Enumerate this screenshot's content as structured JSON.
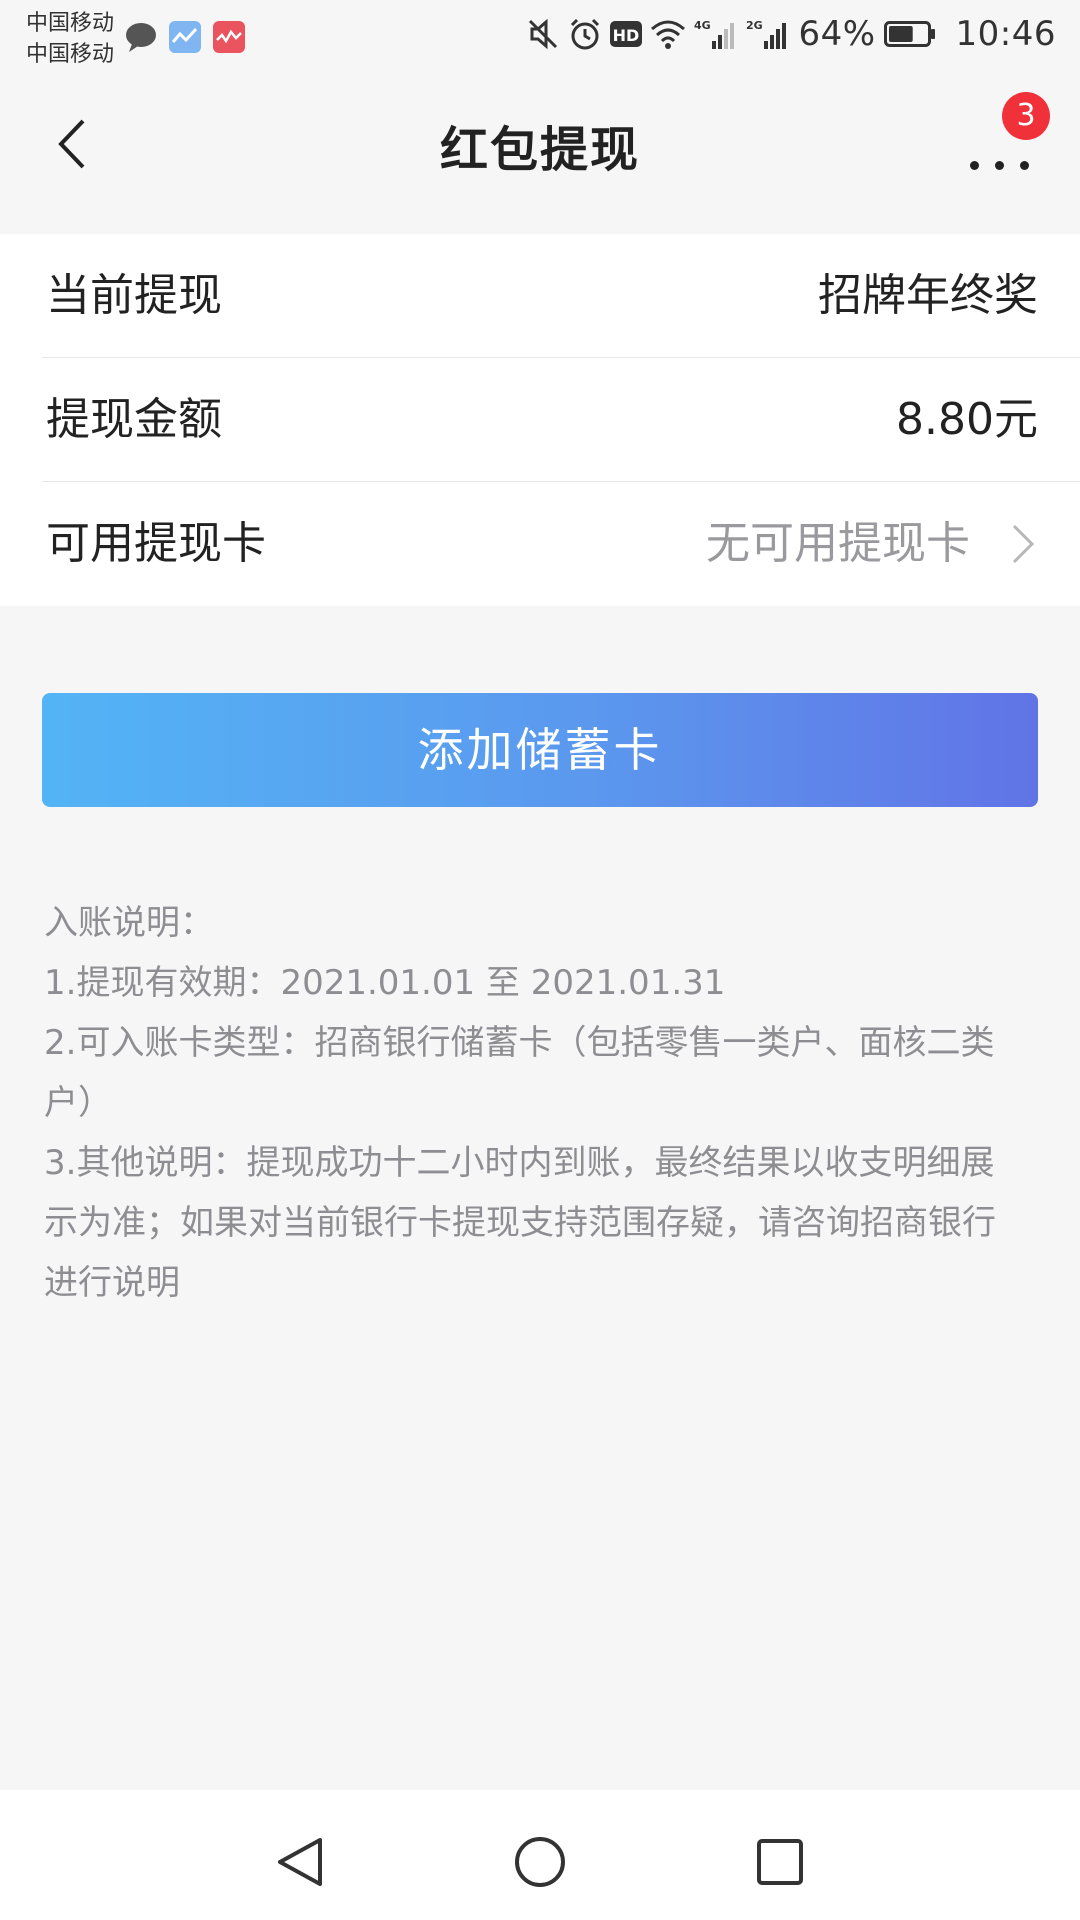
{
  "status_bar": {
    "carrier_line_1": "中国移动",
    "carrier_line_2": "中国移动",
    "notification_icons": [
      "chat-bubble-icon",
      "stock-app-icon",
      "red-app-icon"
    ],
    "network_4g": "4G",
    "network_2g": "2G",
    "hd_label": "HD",
    "battery_percent": "64%",
    "battery_level": 0.64,
    "time": "10:46"
  },
  "nav": {
    "title": "红包提现",
    "more_badge_count": "3"
  },
  "withdraw_info": {
    "rows": [
      {
        "label": "当前提现",
        "value": "招牌年终奖"
      },
      {
        "label": "提现金额",
        "value": "8.80元"
      },
      {
        "label": "可用提现卡",
        "value": "无可用提现卡"
      }
    ]
  },
  "actions": {
    "add_card_label": "添加储蓄卡"
  },
  "notes": {
    "title": "入账说明：",
    "line_1": "1.提现有效期：2021.01.01 至 2021.01.31",
    "line_2": "2.可入账卡类型：招商银行储蓄卡（包括零售一类户、面核二类户）",
    "line_3": "3.其他说明：提现成功十二小时内到账，最终结果以收支明细展示为准；如果对当前银行卡提现支持范围存疑，请咨询招商银行进行说明"
  },
  "colors": {
    "button_gradient_start": "#53b4f5",
    "button_gradient_end": "#6174e6",
    "badge_red": "#f0313a",
    "muted_text": "#9a9a9e"
  }
}
